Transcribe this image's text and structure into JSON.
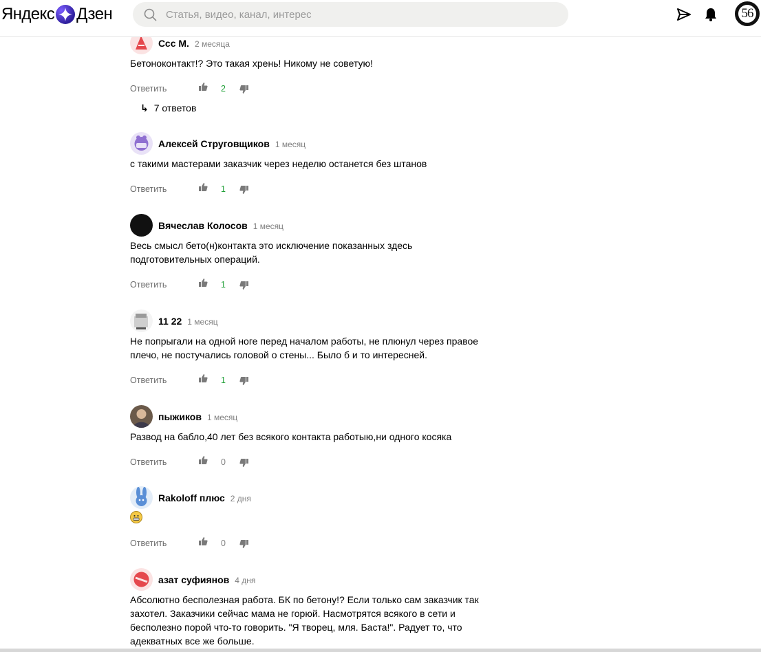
{
  "header": {
    "logo_yandex": "Яндекс",
    "logo_dzen": "Дзен",
    "search_placeholder": "Статья, видео, канал, интерес",
    "user_avatar_text": "56"
  },
  "comments": [
    {
      "author": "Ссс М.",
      "time": "2 месяца",
      "text": "Бетоноконтакт!? Это такая хрень! Никому не советую!",
      "reply_label": "Ответить",
      "likes": "2",
      "replies_label": "7 ответов"
    },
    {
      "author": "Алексей Струговщиков",
      "time": "1 месяц",
      "text": "с такими мастерами заказчик через неделю останется без штанов",
      "reply_label": "Ответить",
      "likes": "1"
    },
    {
      "author": "Вячеслав Колосов",
      "time": "1 месяц",
      "text": "Весь смысл бето(н)контакта это исключение показанных здесь подготовительных операций.",
      "reply_label": "Ответить",
      "likes": "1"
    },
    {
      "author": "11 22",
      "time": "1 месяц",
      "text": "Не попрыгали на одной ноге перед началом работы, не плюнул через правое плечо, не постучались головой о стены... Было б и то интересней.",
      "reply_label": "Ответить",
      "likes": "1"
    },
    {
      "author": "пыжиков",
      "time": "1 месяц",
      "text": "Развод на бабло,40 лет без всякого контакта работыю,ни одного косяка",
      "reply_label": "Ответить",
      "likes": "0"
    },
    {
      "author": "Rakoloff плюс",
      "time": "2 дня",
      "text": "",
      "reply_label": "Ответить",
      "likes": "0"
    },
    {
      "author": "азат суфиянов",
      "time": "4 дня",
      "text": "Абсолютно бесполезная работа. БК по бетону!? Если только сам заказчик так захотел. Заказчики сейчас мама не горюй. Насмотрятся всякого в сети и бесполезно порой что-то говорить. \"Я творец, мля. Баста!\". Радует то, что адекватных все же больше."
    }
  ],
  "colors": {
    "like_positive": "#21a038",
    "muted": "#808080",
    "search_bg": "#f0f0ee"
  }
}
